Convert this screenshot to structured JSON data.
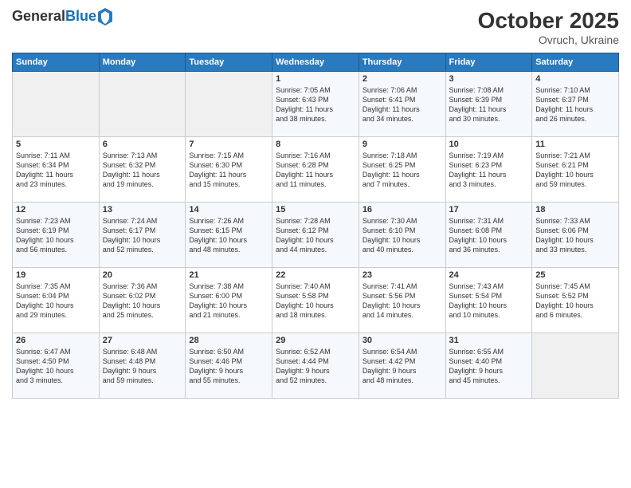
{
  "header": {
    "logo_general": "General",
    "logo_blue": "Blue",
    "month": "October 2025",
    "location": "Ovruch, Ukraine"
  },
  "days_of_week": [
    "Sunday",
    "Monday",
    "Tuesday",
    "Wednesday",
    "Thursday",
    "Friday",
    "Saturday"
  ],
  "weeks": [
    [
      {
        "num": "",
        "info": ""
      },
      {
        "num": "",
        "info": ""
      },
      {
        "num": "",
        "info": ""
      },
      {
        "num": "1",
        "info": "Sunrise: 7:05 AM\nSunset: 6:43 PM\nDaylight: 11 hours\nand 38 minutes."
      },
      {
        "num": "2",
        "info": "Sunrise: 7:06 AM\nSunset: 6:41 PM\nDaylight: 11 hours\nand 34 minutes."
      },
      {
        "num": "3",
        "info": "Sunrise: 7:08 AM\nSunset: 6:39 PM\nDaylight: 11 hours\nand 30 minutes."
      },
      {
        "num": "4",
        "info": "Sunrise: 7:10 AM\nSunset: 6:37 PM\nDaylight: 11 hours\nand 26 minutes."
      }
    ],
    [
      {
        "num": "5",
        "info": "Sunrise: 7:11 AM\nSunset: 6:34 PM\nDaylight: 11 hours\nand 23 minutes."
      },
      {
        "num": "6",
        "info": "Sunrise: 7:13 AM\nSunset: 6:32 PM\nDaylight: 11 hours\nand 19 minutes."
      },
      {
        "num": "7",
        "info": "Sunrise: 7:15 AM\nSunset: 6:30 PM\nDaylight: 11 hours\nand 15 minutes."
      },
      {
        "num": "8",
        "info": "Sunrise: 7:16 AM\nSunset: 6:28 PM\nDaylight: 11 hours\nand 11 minutes."
      },
      {
        "num": "9",
        "info": "Sunrise: 7:18 AM\nSunset: 6:25 PM\nDaylight: 11 hours\nand 7 minutes."
      },
      {
        "num": "10",
        "info": "Sunrise: 7:19 AM\nSunset: 6:23 PM\nDaylight: 11 hours\nand 3 minutes."
      },
      {
        "num": "11",
        "info": "Sunrise: 7:21 AM\nSunset: 6:21 PM\nDaylight: 10 hours\nand 59 minutes."
      }
    ],
    [
      {
        "num": "12",
        "info": "Sunrise: 7:23 AM\nSunset: 6:19 PM\nDaylight: 10 hours\nand 56 minutes."
      },
      {
        "num": "13",
        "info": "Sunrise: 7:24 AM\nSunset: 6:17 PM\nDaylight: 10 hours\nand 52 minutes."
      },
      {
        "num": "14",
        "info": "Sunrise: 7:26 AM\nSunset: 6:15 PM\nDaylight: 10 hours\nand 48 minutes."
      },
      {
        "num": "15",
        "info": "Sunrise: 7:28 AM\nSunset: 6:12 PM\nDaylight: 10 hours\nand 44 minutes."
      },
      {
        "num": "16",
        "info": "Sunrise: 7:30 AM\nSunset: 6:10 PM\nDaylight: 10 hours\nand 40 minutes."
      },
      {
        "num": "17",
        "info": "Sunrise: 7:31 AM\nSunset: 6:08 PM\nDaylight: 10 hours\nand 36 minutes."
      },
      {
        "num": "18",
        "info": "Sunrise: 7:33 AM\nSunset: 6:06 PM\nDaylight: 10 hours\nand 33 minutes."
      }
    ],
    [
      {
        "num": "19",
        "info": "Sunrise: 7:35 AM\nSunset: 6:04 PM\nDaylight: 10 hours\nand 29 minutes."
      },
      {
        "num": "20",
        "info": "Sunrise: 7:36 AM\nSunset: 6:02 PM\nDaylight: 10 hours\nand 25 minutes."
      },
      {
        "num": "21",
        "info": "Sunrise: 7:38 AM\nSunset: 6:00 PM\nDaylight: 10 hours\nand 21 minutes."
      },
      {
        "num": "22",
        "info": "Sunrise: 7:40 AM\nSunset: 5:58 PM\nDaylight: 10 hours\nand 18 minutes."
      },
      {
        "num": "23",
        "info": "Sunrise: 7:41 AM\nSunset: 5:56 PM\nDaylight: 10 hours\nand 14 minutes."
      },
      {
        "num": "24",
        "info": "Sunrise: 7:43 AM\nSunset: 5:54 PM\nDaylight: 10 hours\nand 10 minutes."
      },
      {
        "num": "25",
        "info": "Sunrise: 7:45 AM\nSunset: 5:52 PM\nDaylight: 10 hours\nand 6 minutes."
      }
    ],
    [
      {
        "num": "26",
        "info": "Sunrise: 6:47 AM\nSunset: 4:50 PM\nDaylight: 10 hours\nand 3 minutes."
      },
      {
        "num": "27",
        "info": "Sunrise: 6:48 AM\nSunset: 4:48 PM\nDaylight: 9 hours\nand 59 minutes."
      },
      {
        "num": "28",
        "info": "Sunrise: 6:50 AM\nSunset: 4:46 PM\nDaylight: 9 hours\nand 55 minutes."
      },
      {
        "num": "29",
        "info": "Sunrise: 6:52 AM\nSunset: 4:44 PM\nDaylight: 9 hours\nand 52 minutes."
      },
      {
        "num": "30",
        "info": "Sunrise: 6:54 AM\nSunset: 4:42 PM\nDaylight: 9 hours\nand 48 minutes."
      },
      {
        "num": "31",
        "info": "Sunrise: 6:55 AM\nSunset: 4:40 PM\nDaylight: 9 hours\nand 45 minutes."
      },
      {
        "num": "",
        "info": ""
      }
    ]
  ]
}
